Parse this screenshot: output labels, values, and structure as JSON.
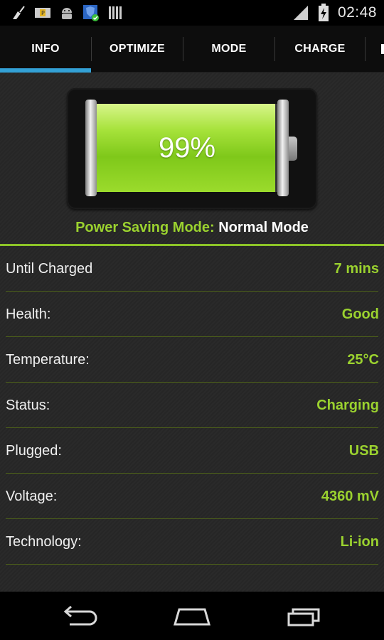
{
  "status_bar": {
    "time": "02:48",
    "icons": [
      "cleaner-broom-icon",
      "parking-icon",
      "android-icon",
      "shield-check-icon",
      "barcode-icon",
      "signal-icon",
      "battery-charging-icon"
    ]
  },
  "tabs": [
    {
      "label": "INFO",
      "selected": true
    },
    {
      "label": "OPTIMIZE",
      "selected": false
    },
    {
      "label": "MODE",
      "selected": false
    },
    {
      "label": "CHARGE",
      "selected": false
    },
    {
      "label": "",
      "selected": false
    }
  ],
  "battery": {
    "level_percent": 99,
    "label": "99%",
    "fill_color": "#9bdb2c"
  },
  "power_saving": {
    "label": "Power Saving Mode:",
    "value": "Normal Mode"
  },
  "info_rows": [
    {
      "label": "Until Charged",
      "value": "7 mins"
    },
    {
      "label": "Health:",
      "value": "Good"
    },
    {
      "label": "Temperature:",
      "value": "25°C"
    },
    {
      "label": "Status:",
      "value": "Charging"
    },
    {
      "label": "Plugged:",
      "value": "USB"
    },
    {
      "label": "Voltage:",
      "value": "4360 mV"
    },
    {
      "label": "Technology:",
      "value": "Li-ion"
    }
  ],
  "colors": {
    "accent_green": "#9bd22f",
    "tab_indicator": "#33a1d6"
  },
  "nav_bar": {
    "icons": [
      "back-icon",
      "home-icon",
      "recent-apps-icon"
    ]
  }
}
